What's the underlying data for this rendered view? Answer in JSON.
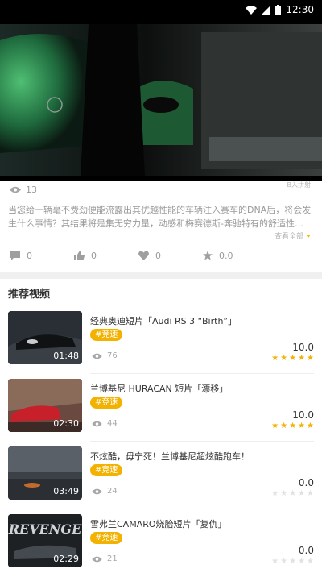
{
  "status": {
    "time": "12:30"
  },
  "video": {
    "views": "13",
    "corner_text": "B入拼射"
  },
  "description": {
    "text": "当您给一辆毫不费劲便能流露出其优越性能的车辆注入赛车的DNA后，将会发生什么事情？其结果将是集无穷力量，动感和梅赛德斯-奔驰特有的舒适性…",
    "expand_label": "查看全部"
  },
  "actions": [
    {
      "name": "comment",
      "count": "0"
    },
    {
      "name": "like",
      "count": "0"
    },
    {
      "name": "favorite",
      "count": "0"
    },
    {
      "name": "rating",
      "count": "0.0"
    }
  ],
  "recommend": {
    "section_title": "推荐视频",
    "items": [
      {
        "title": "经典奥迪短片「Audi RS 3 “Birth”」",
        "tag": "#竞速",
        "duration": "01:48",
        "views": "76",
        "score": "10.0",
        "stars_filled": 5
      },
      {
        "title": "兰博基尼 HURACAN 短片「漂移」",
        "tag": "#竞速",
        "duration": "02:30",
        "views": "44",
        "score": "10.0",
        "stars_filled": 5
      },
      {
        "title": "不炫酷，毋宁死！兰博基尼超炫酷跑车！",
        "tag": "#竞速",
        "duration": "03:49",
        "views": "24",
        "score": "0.0",
        "stars_filled": 0
      },
      {
        "title": "雪弗兰CAMARO烧胎短片「复仇」",
        "tag": "#竞速",
        "duration": "02:29",
        "views": "21",
        "score": "0.0",
        "stars_filled": 0
      }
    ],
    "thumb_text_4": "REVENGE"
  },
  "colors": {
    "accent": "#f3b200",
    "star_empty": "#e2e2e2"
  }
}
